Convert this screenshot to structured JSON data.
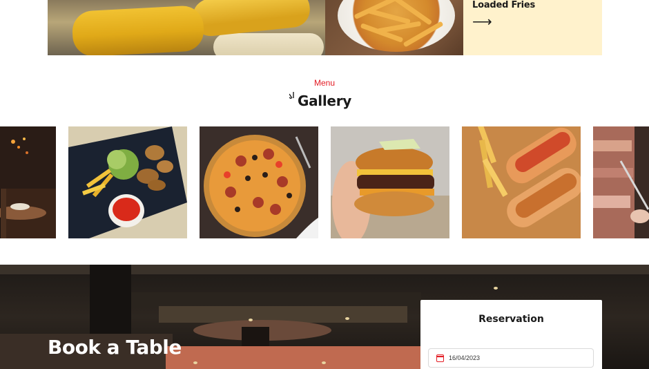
{
  "top_feature": {
    "card_title": "Loaded Fries",
    "card_arrow": "⟶"
  },
  "gallery_section": {
    "kicker": "Menu",
    "title": "Gallery",
    "items": [
      {
        "name": "restaurant-interior"
      },
      {
        "name": "fried-chicken-with-dip"
      },
      {
        "name": "pizza"
      },
      {
        "name": "burger"
      },
      {
        "name": "hot-dogs-with-fries"
      },
      {
        "name": "shawarma-meat"
      }
    ]
  },
  "booking": {
    "title": "Book a Table",
    "reservation": {
      "title": "Reservation",
      "date_value": "16/04/2023"
    }
  },
  "colors": {
    "accent": "#e31b23",
    "card_bg": "#fff2cc",
    "dark_section": "#1e1a17"
  }
}
